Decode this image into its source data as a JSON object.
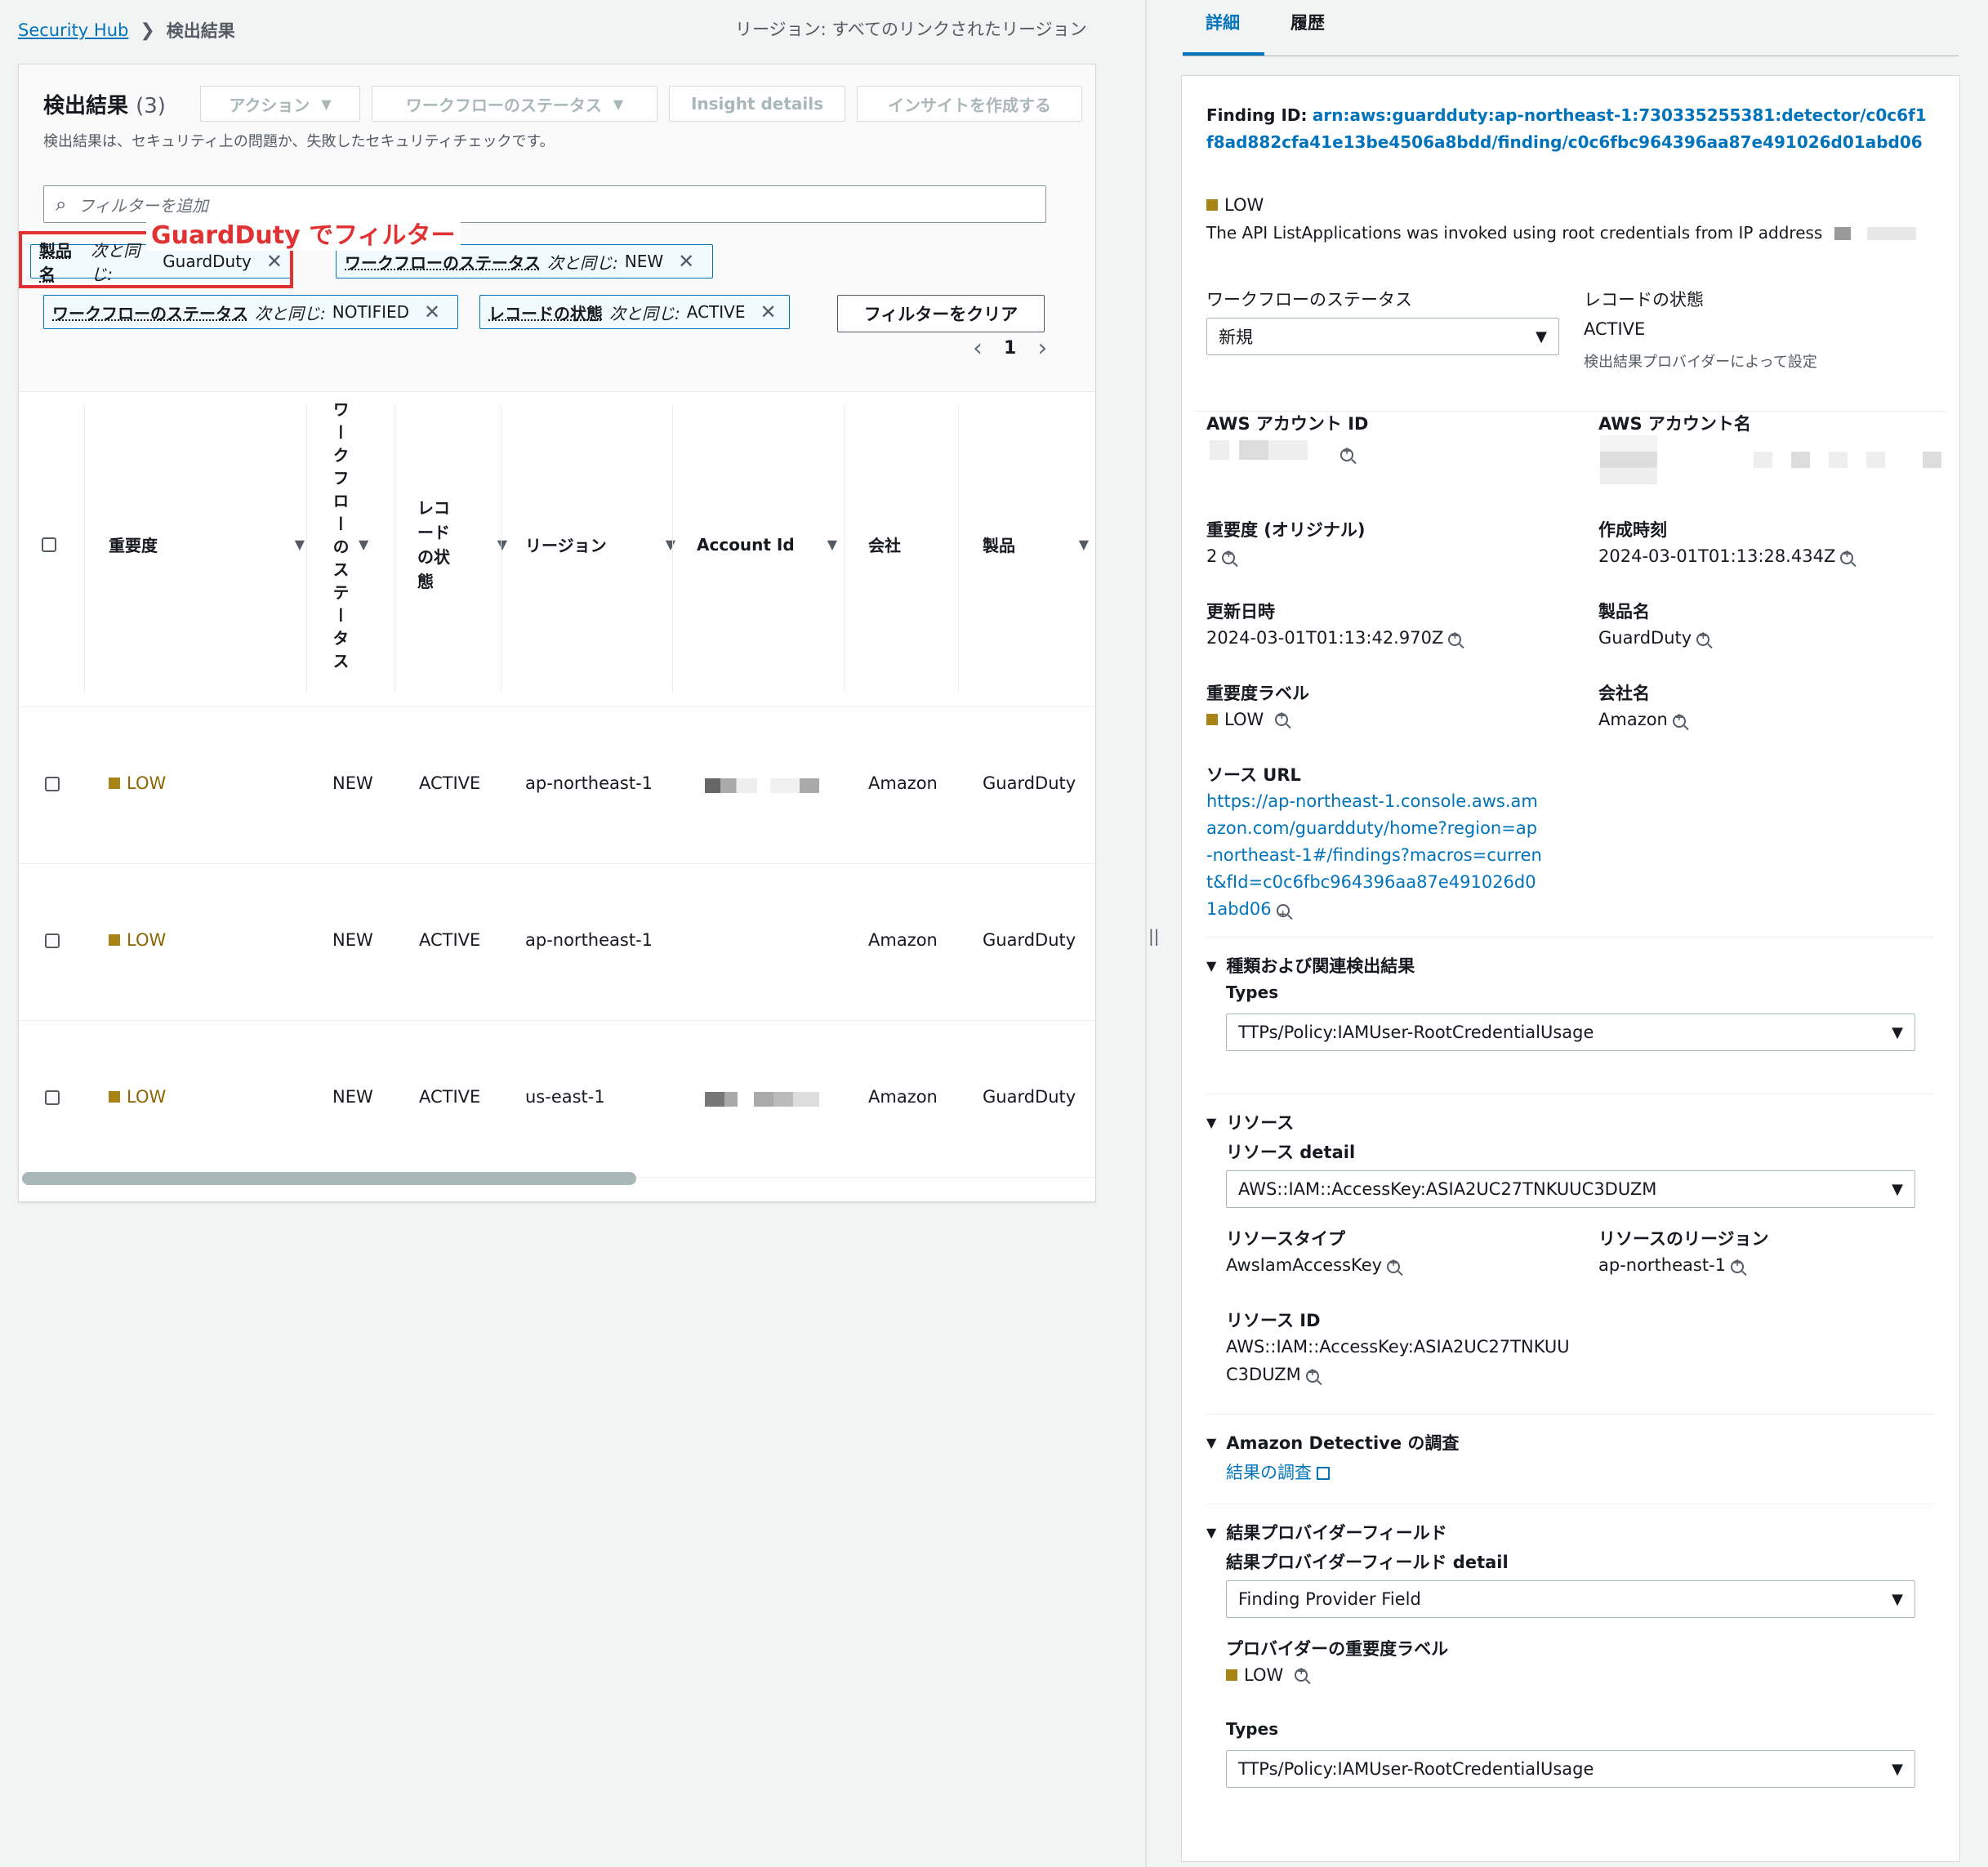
{
  "breadcrumb": {
    "root": "Security Hub",
    "current": "検出結果"
  },
  "region_label": "リージョン: すべてのリンクされたリージョン",
  "findings": {
    "title": "検出結果",
    "count": "(3)",
    "description": "検出結果は、セキュリティ上の問題か、失敗したセキュリティチェックです。",
    "buttons": {
      "actions": "アクション",
      "workflow_status": "ワークフローのステータス",
      "insight_details": "Insight details",
      "create_insight": "インサイトを作成する"
    },
    "search_placeholder": "フィルターを追加",
    "annotation": "GuardDuty でフィルター",
    "filters": [
      {
        "key": "製品名",
        "op": "次と同じ:",
        "value": "GuardDuty"
      },
      {
        "key": "ワークフローのステータス",
        "op": "次と同じ:",
        "value": "NEW"
      },
      {
        "key": "ワークフローのステータス",
        "op": "次と同じ:",
        "value": "NOTIFIED"
      },
      {
        "key": "レコードの状態",
        "op": "次と同じ:",
        "value": "ACTIVE"
      }
    ],
    "clear_filters": "フィルターをクリア",
    "page": "1",
    "columns": {
      "severity": "重要度",
      "workflow_status": "ワークフローのステータス",
      "record_state": "レコードの状態",
      "region": "リージョン",
      "account_id": "Account Id",
      "company": "会社",
      "product": "製品"
    },
    "rows": [
      {
        "severity": "LOW",
        "workflow": "NEW",
        "record": "ACTIVE",
        "region": "ap-northeast-1",
        "company": "Amazon",
        "product": "GuardDuty"
      },
      {
        "severity": "LOW",
        "workflow": "NEW",
        "record": "ACTIVE",
        "region": "ap-northeast-1",
        "company": "Amazon",
        "product": "GuardDuty"
      },
      {
        "severity": "LOW",
        "workflow": "NEW",
        "record": "ACTIVE",
        "region": "us-east-1",
        "company": "Amazon",
        "product": "GuardDuty"
      }
    ]
  },
  "detail": {
    "tabs": {
      "detail": "詳細",
      "history": "履歴"
    },
    "finding_id_label": "Finding ID:",
    "finding_id": "arn:aws:guardduty:ap-northeast-1:730335255381:detector/c0c6f1f8ad882cfa41e13be4506a8bdd/finding/c0c6fbc964396aa87e491026d01abd06",
    "severity": "LOW",
    "summary": "The API ListApplications was invoked using root credentials from IP address",
    "workflow_label": "ワークフローのステータス",
    "workflow_value": "新規",
    "record_label": "レコードの状態",
    "record_value": "ACTIVE",
    "record_note": "検出結果プロバイダーによって設定",
    "account_id_label": "AWS アカウント ID",
    "account_name_label": "AWS アカウント名",
    "orig_severity_label": "重要度 (オリジナル)",
    "orig_severity_value": "2",
    "created_label": "作成時刻",
    "created_value": "2024-03-01T01:13:28.434Z",
    "updated_label": "更新日時",
    "updated_value": "2024-03-01T01:13:42.970Z",
    "product_label": "製品名",
    "product_value": "GuardDuty",
    "sev_label_label": "重要度ラベル",
    "sev_label_value": "LOW",
    "company_label": "会社名",
    "company_value": "Amazon",
    "source_url_label": "ソース URL",
    "source_url": "https://ap-northeast-1.console.aws.amazon.com/guardduty/home?region=ap-northeast-1#/findings?macros=current&fId=c0c6fbc964396aa87e491026d01abd06",
    "types_section": "種類および関連検出結果",
    "types_label": "Types",
    "types_value": "TTPs/Policy:IAMUser-RootCredentialUsage",
    "resources_section": "リソース",
    "resource_detail_label": "リソース detail",
    "resource_detail_value": "AWS::IAM::AccessKey:ASIA2UC27TNKUUC3DUZM",
    "resource_type_label": "リソースタイプ",
    "resource_type_value": "AwsIamAccessKey",
    "resource_region_label": "リソースのリージョン",
    "resource_region_value": "ap-northeast-1",
    "resource_id_label": "リソース ID",
    "resource_id_line1": "AWS::IAM::AccessKey:ASIA2UC27TNKUU",
    "resource_id_line2": "C3DUZM",
    "detective_section": "Amazon Detective の調査",
    "detective_link": "結果の調査",
    "provider_section": "結果プロバイダーフィールド",
    "provider_detail_label": "結果プロバイダーフィールド detail",
    "provider_detail_value": "Finding Provider Field",
    "provider_sev_label": "プロバイダーの重要度ラベル",
    "provider_sev_value": "LOW",
    "provider_types_label": "Types",
    "provider_types_value": "TTPs/Policy:IAMUser-RootCredentialUsage"
  },
  "colors": {
    "link": "#0073bb",
    "annotation": "#e03232",
    "low": "#a88416"
  }
}
